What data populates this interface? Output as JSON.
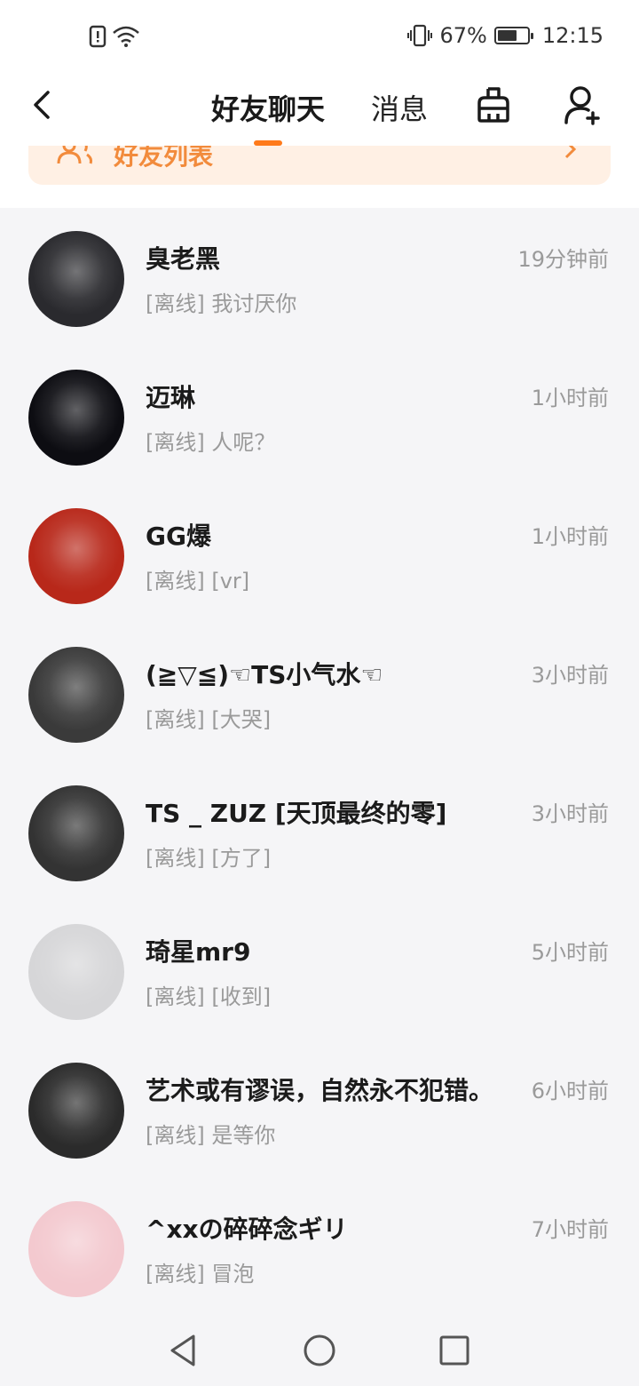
{
  "status_bar": {
    "battery_percent_text": "67%",
    "battery_level": 0.67,
    "time": "12:15",
    "icons": [
      "alert-icon",
      "wifi-icon",
      "vibrate-icon",
      "battery-icon"
    ]
  },
  "header": {
    "tabs": [
      {
        "label": "好友聊天",
        "active": true
      },
      {
        "label": "消息",
        "active": false
      }
    ],
    "icons": [
      "back-icon",
      "broom-icon",
      "add-friend-icon"
    ]
  },
  "banner": {
    "label": "好友列表"
  },
  "chats": [
    {
      "name": "臭老黑",
      "time": "19分钟前",
      "preview": "[离线] 我讨厌你",
      "avatar_color": "#2a2a2e"
    },
    {
      "name": "迈琳",
      "time": "1小时前",
      "preview": "[离线] 人呢？",
      "avatar_color": "#0d0d12"
    },
    {
      "name": "GG爆",
      "time": "1小时前",
      "preview": "[离线] [vr]",
      "avatar_color": "#b8281a"
    },
    {
      "name": "(≧▽≦)☜TS小气水☜",
      "time": "3小时前",
      "preview": "[离线] [大哭]",
      "avatar_color": "#3a3a3a"
    },
    {
      "name": "TS _ ZUZ [天顶最终的零]",
      "time": "3小时前",
      "preview": "[离线] [方了]",
      "avatar_color": "#333333"
    },
    {
      "name": "琦星mr9",
      "time": "5小时前",
      "preview": "[离线] [收到]",
      "avatar_color": "#d6d6d8"
    },
    {
      "name": "艺术或有谬误，自然永不犯错。",
      "time": "6小时前",
      "preview": "[离线] 是等你",
      "avatar_color": "#2b2b2b"
    },
    {
      "name": "^xxの碎碎念ギリ",
      "time": "7小时前",
      "preview": "[离线] 冒泡",
      "avatar_color": "#f3c9cf"
    }
  ],
  "colors": {
    "accent": "#ff7a1a",
    "banner_bg": "#fff0e4",
    "muted_text": "#9a9a9a"
  },
  "nav": {
    "icons": [
      "back-triangle-icon",
      "home-circle-icon",
      "recents-square-icon"
    ]
  }
}
